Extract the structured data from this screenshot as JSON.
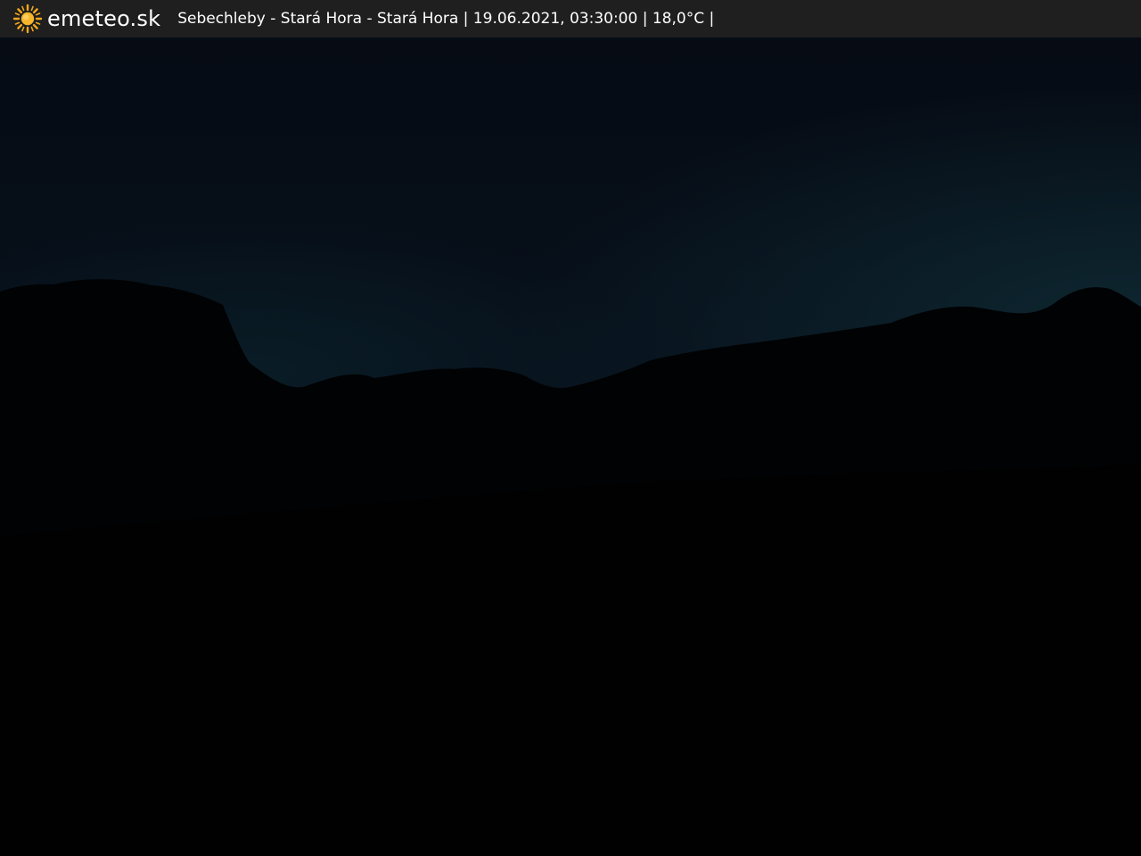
{
  "header": {
    "logo_icon": "sun-icon",
    "brand": "emeteo.sk",
    "caption": "Sebechleby - Stará Hora - Stará Hora | 19.06.2021, 03:30:00 | 18,0°C |"
  },
  "colors": {
    "bar_background": "#1f1f1f",
    "sun": "#f3a81c",
    "text": "#ffffff"
  }
}
